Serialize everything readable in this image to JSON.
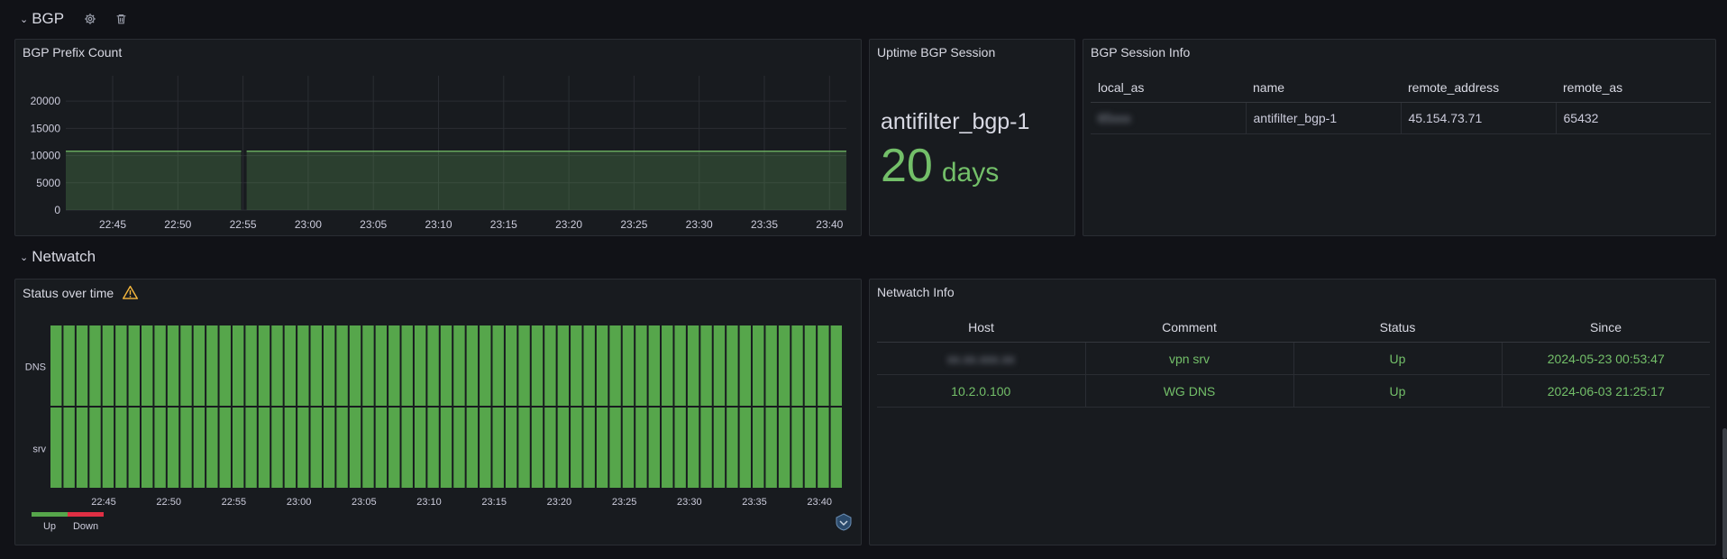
{
  "rows": {
    "bgp": {
      "title": "BGP"
    },
    "netwatch": {
      "title": "Netwatch"
    }
  },
  "panels": {
    "prefix_count": {
      "title": "BGP Prefix Count"
    },
    "uptime": {
      "title": "Uptime BGP Session",
      "name": "antifilter_bgp-1",
      "value": "20",
      "unit": "days"
    },
    "session_info": {
      "title": "BGP Session Info",
      "columns": [
        "local_as",
        "name",
        "remote_address",
        "remote_as"
      ],
      "rows": [
        [
          "65xxx",
          "antifilter_bgp-1",
          "45.154.73.71",
          "65432"
        ]
      ]
    },
    "status": {
      "title": "Status over time",
      "warning_icon": "warning-triangle-icon"
    },
    "netwatch_info": {
      "title": "Netwatch Info",
      "columns": [
        "Host",
        "Comment",
        "Status",
        "Since"
      ],
      "rows": [
        [
          "xx.xx.xxx.xx",
          "vpn srv",
          "Up",
          "2024-05-23 00:53:47"
        ],
        [
          "10.2.0.100",
          "WG DNS",
          "Up",
          "2024-06-03 21:25:17"
        ]
      ]
    }
  },
  "colors": {
    "green": "#73bf69",
    "up": "#56a64b",
    "down": "#e02f44",
    "panel_bg": "#181b1f",
    "page_bg": "#111217"
  },
  "chart_data": [
    {
      "type": "area",
      "title": "BGP Prefix Count",
      "y_ticks": [
        "20000",
        "15000",
        "10000",
        "5000",
        "0"
      ],
      "ylim": [
        0,
        23000
      ],
      "x_ticks": [
        "22:45",
        "22:50",
        "22:55",
        "23:00",
        "23:05",
        "23:10",
        "23:15",
        "23:20",
        "23:25",
        "23:30",
        "23:35",
        "23:40"
      ],
      "series": [
        {
          "values": [
            10800,
            10800,
            10800,
            10800,
            10800,
            10800,
            10800,
            10800,
            10800,
            10800,
            10800,
            10800,
            10800
          ]
        }
      ],
      "gap_at": "22:55",
      "grid": true
    },
    {
      "type": "heatmap",
      "title": "Status over time",
      "categories": [
        "DNS",
        "srv"
      ],
      "x_ticks": [
        "22:45",
        "22:50",
        "22:55",
        "23:00",
        "23:05",
        "23:10",
        "23:15",
        "23:20",
        "23:25",
        "23:30",
        "23:35",
        "23:40"
      ],
      "legend": [
        "Up",
        "Down"
      ],
      "status_per_column": "Up",
      "columns": 61
    }
  ]
}
